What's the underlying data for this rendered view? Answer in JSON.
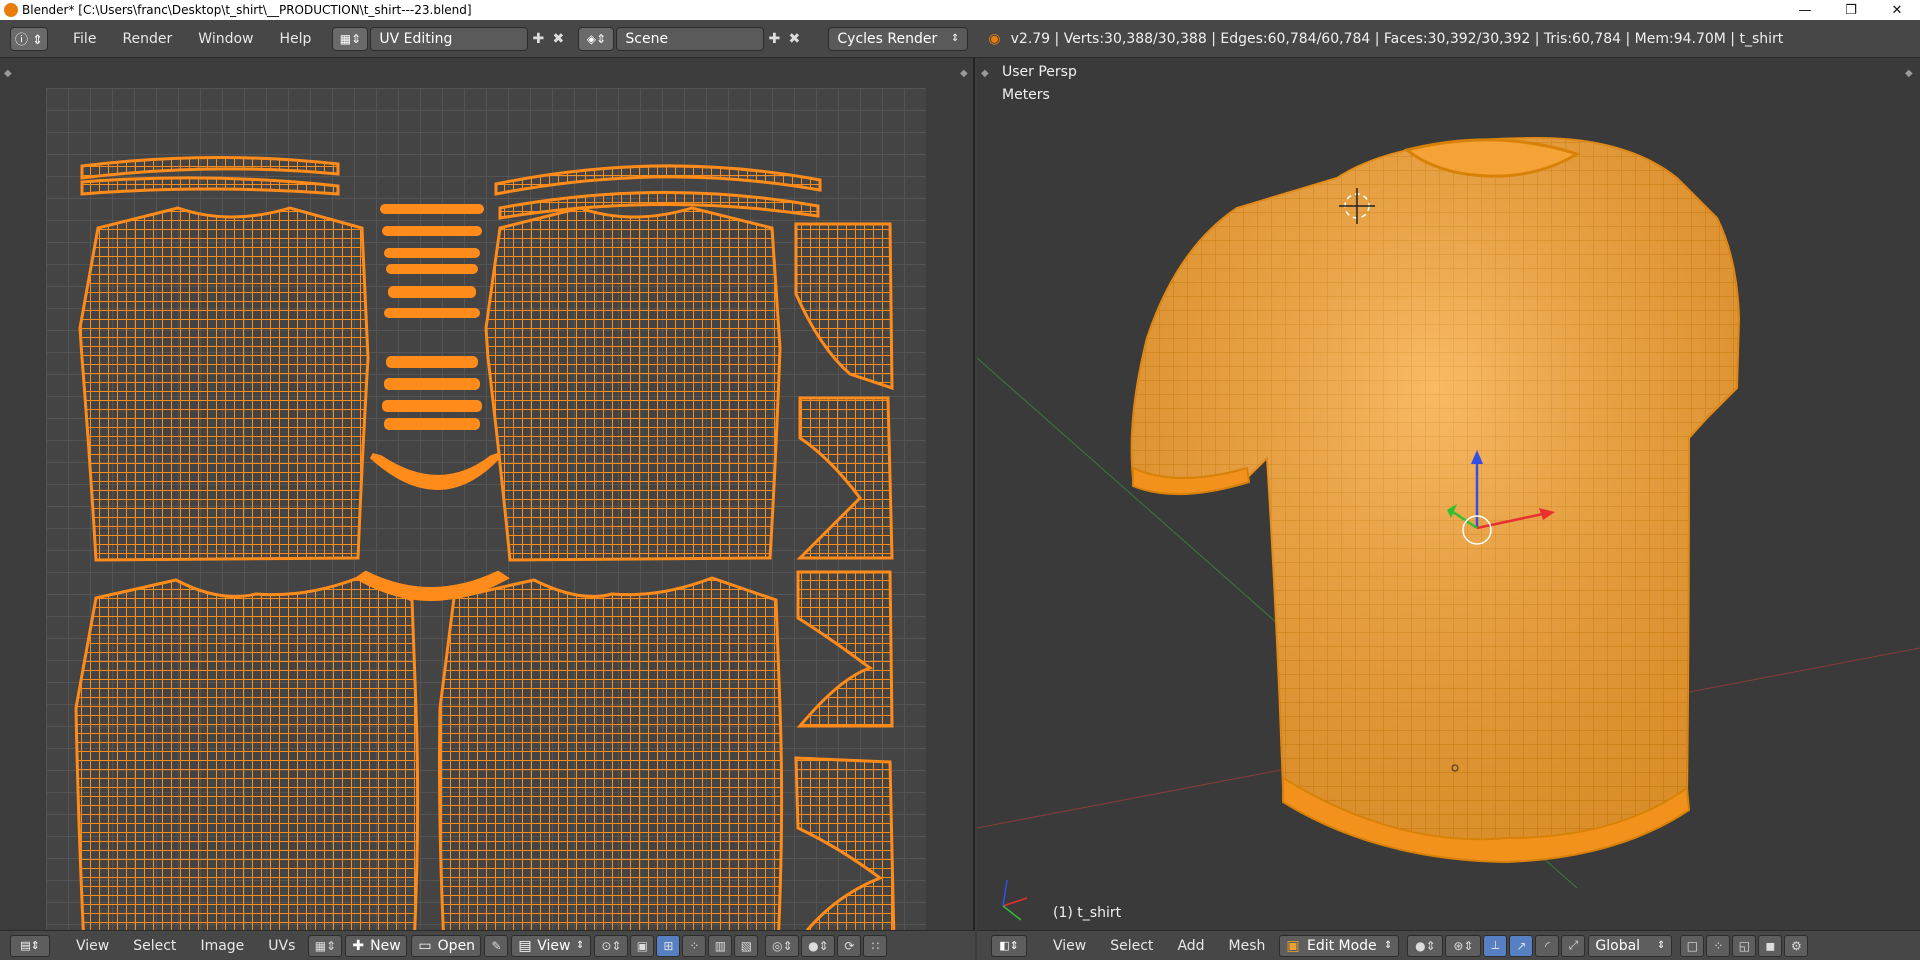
{
  "window": {
    "title": "Blender* [C:\\Users\\franc\\Desktop\\t_shirt\\__PRODUCTION\\t_shirt---23.blend]",
    "controls": [
      "—",
      "❐",
      "✕"
    ]
  },
  "infobar": {
    "menu": [
      "File",
      "Render",
      "Window",
      "Help"
    ],
    "screen_layout": "UV Editing",
    "scene": "Scene",
    "render_engine": "Cycles Render",
    "stats": "v2.79 | Verts:30,388/30,388 | Edges:60,784/60,784 | Faces:30,392/30,392 | Tris:60,784 | Mem:94.70M | t_shirt"
  },
  "viewport": {
    "view_name": "User Persp",
    "units": "Meters",
    "object_label": "(1) t_shirt"
  },
  "uv_footer": {
    "menu": [
      "View",
      "Select",
      "Image",
      "UVs"
    ],
    "new_label": "New",
    "open_label": "Open",
    "view_label": "View"
  },
  "view3d_footer": {
    "menu": [
      "View",
      "Select",
      "Add",
      "Mesh"
    ],
    "mode": "Edit Mode",
    "orientation": "Global"
  },
  "colors": {
    "accent": "#f08c16",
    "mesh_fill": "#f7a63a",
    "wire": "#d98608"
  }
}
